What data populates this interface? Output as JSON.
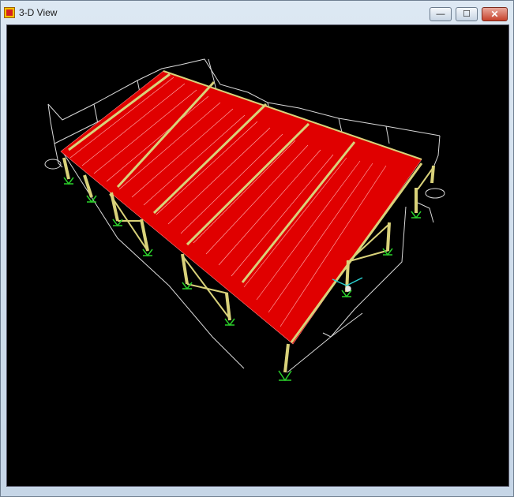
{
  "window": {
    "title": "3-D View",
    "icons": {
      "app": "sap-app-icon",
      "minimize": "minimize-icon",
      "maximize": "maximize-icon",
      "close": "close-icon"
    },
    "glyphs": {
      "minimize": "—",
      "maximize": "☐",
      "close": "✕"
    }
  },
  "colors": {
    "roof": "#e00000",
    "frame": "#d9d27a",
    "wire": "#d9d9d9",
    "supports": "#2ad02a",
    "background": "#000000"
  }
}
